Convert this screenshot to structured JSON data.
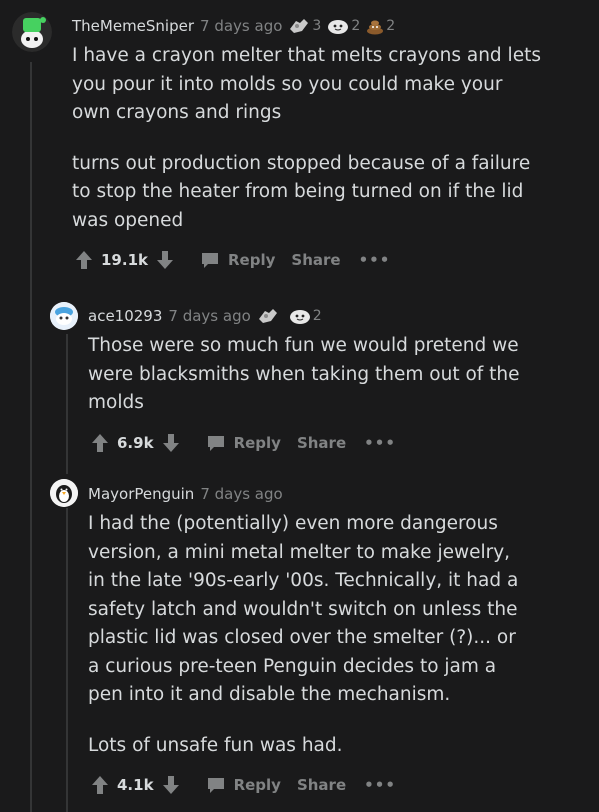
{
  "comments": [
    {
      "username": "TheMemeSniper",
      "time": "7 days ago",
      "awards": [
        {
          "icon": "silver-award-icon",
          "count": "3"
        },
        {
          "icon": "wholesome-award-icon",
          "count": "2"
        },
        {
          "icon": "poop-award-icon",
          "count": "2"
        }
      ],
      "paragraphs": [
        "I have a crayon melter that melts crayons and lets you pour it into molds so you could make your own crayons and rings",
        "turns out production stopped because of a failure to stop the heater from being turned on if the lid was opened"
      ],
      "score": "19.1k",
      "reply_label": "Reply",
      "share_label": "Share",
      "more_label": "•••"
    },
    {
      "username": "ace10293",
      "time": "7 days ago",
      "awards": [
        {
          "icon": "silver-award-icon",
          "count": ""
        },
        {
          "icon": "wholesome-award-icon",
          "count": "2"
        }
      ],
      "paragraphs": [
        "Those were so much fun we would pretend we were blacksmiths when taking them out of the molds"
      ],
      "score": "6.9k",
      "reply_label": "Reply",
      "share_label": "Share",
      "more_label": "•••"
    },
    {
      "username": "MayorPenguin",
      "time": "7 days ago",
      "awards": [],
      "paragraphs": [
        "I had the (potentially) even more dangerous version, a mini metal melter to make jewelry, in the late '90s-early '00s. Technically, it had a safety latch and wouldn't switch on unless the plastic lid was closed over the smelter (?)... or a curious pre-teen Penguin decides to jam a pen into it and disable the mechanism.",
        "Lots of unsafe fun was had."
      ],
      "score": "4.1k",
      "reply_label": "Reply",
      "share_label": "Share",
      "more_label": "•••"
    }
  ],
  "colors": {
    "background": "#1a1a1b",
    "text": "#d7dadc",
    "meta": "#818384",
    "thread_line": "#343536"
  }
}
